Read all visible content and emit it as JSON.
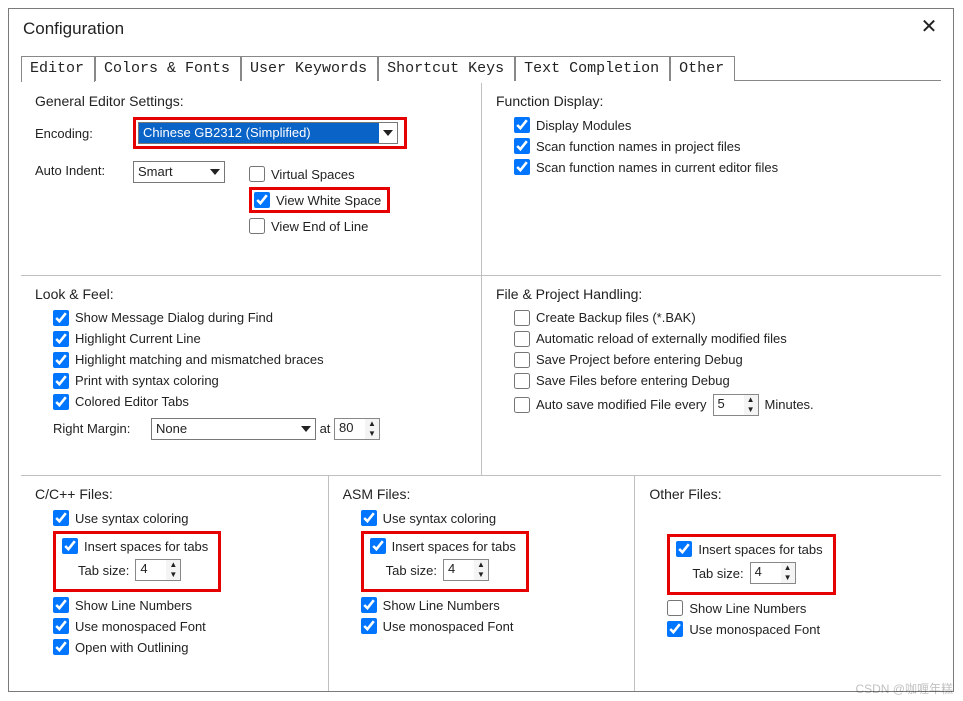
{
  "window": {
    "title": "Configuration"
  },
  "tabs": {
    "editor": "Editor",
    "colors": "Colors & Fonts",
    "userkw": "User Keywords",
    "shortcut": "Shortcut Keys",
    "textcomp": "Text Completion",
    "other": "Other"
  },
  "general": {
    "title": "General Editor Settings:",
    "encoding_label": "Encoding:",
    "encoding_value": "Chinese GB2312 (Simplified)",
    "autoindent_label": "Auto Indent:",
    "autoindent_value": "Smart",
    "virtual_spaces": "Virtual Spaces",
    "view_white_space": "View White Space",
    "view_eol": "View End of Line"
  },
  "func": {
    "title": "Function Display:",
    "display_modules": "Display Modules",
    "scan_proj": "Scan function names in project files",
    "scan_editor": "Scan function names in current editor files"
  },
  "look": {
    "title": "Look & Feel:",
    "msg_dialog": "Show Message Dialog during Find",
    "highlight_line": "Highlight Current Line",
    "highlight_brace": "Highlight matching and mismatched braces",
    "syntax_print": "Print with syntax coloring",
    "colored_tabs": "Colored Editor Tabs",
    "right_margin_label": "Right Margin:",
    "right_margin_value": "None",
    "at_label": "at",
    "at_value": "80"
  },
  "fph": {
    "title": "File & Project Handling:",
    "backup": "Create Backup files (*.BAK)",
    "reload": "Automatic reload of externally modified files",
    "save_proj": "Save Project before entering Debug",
    "save_files": "Save Files before entering Debug",
    "autosave_pre": "Auto save modified File every",
    "autosave_value": "5",
    "autosave_post": "Minutes."
  },
  "cc": {
    "title": "C/C++ Files:",
    "use_syntax": true,
    "insert_spaces": true,
    "tab_size": "4",
    "line_numbers": true,
    "mono_font": true,
    "open_outline": true
  },
  "asm": {
    "title": "ASM Files:",
    "use_syntax": true,
    "insert_spaces": true,
    "tab_size": "4",
    "line_numbers": true,
    "mono_font": true
  },
  "oth": {
    "title": "Other Files:",
    "insert_spaces": true,
    "tab_size": "4",
    "line_numbers": false,
    "mono_font": true
  },
  "labels": {
    "use_syntax": "Use syntax coloring",
    "insert_spaces": "Insert spaces for tabs",
    "tab_size": "Tab size:",
    "line_numbers": "Show Line Numbers",
    "mono_font": "Use monospaced Font",
    "open_outline": "Open with Outlining"
  },
  "watermark": "CSDN @咖喱年糕"
}
